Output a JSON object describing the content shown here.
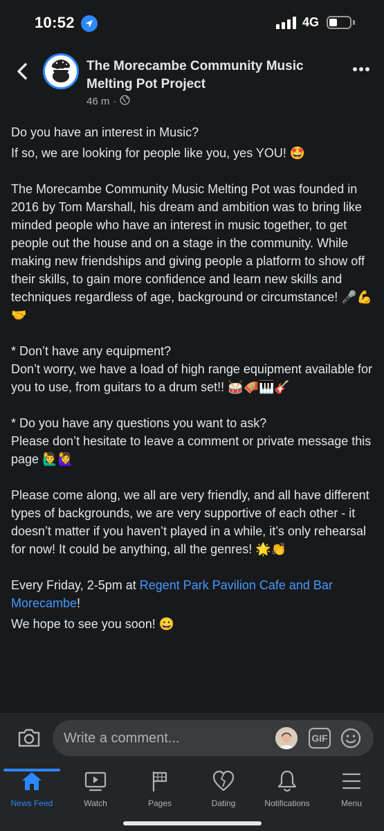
{
  "status_bar": {
    "time": "10:52",
    "network": "4G",
    "location_icon": "location-arrow-icon",
    "signal_icon": "cellular-signal-icon",
    "battery_icon": "battery-icon",
    "battery_level": 0.4
  },
  "post": {
    "page_name": "The Morecambe Community Music Melting Pot Project",
    "time_ago": "46 m",
    "separator": "·",
    "audience_icon": "globe-icon",
    "paragraphs": {
      "p1a": "Do you have an interest in Music?",
      "p1b": "If so, we are looking for people like you, yes YOU! 🤩",
      "p2": "The Morecambe Community Music Melting Pot was founded in 2016 by Tom Marshall, his dream and ambition was to bring like minded people who have an interest in music together, to get people out the house and on a stage in the community. While making new friendships and giving people a platform to show off their skills, to gain more confidence and learn new skills and techniques regardless of age, background or circumstance! 🎤💪🤝",
      "p3a": "* Don’t have any equipment?",
      "p3b": "Don’t worry, we have a load of high range equipment available for you to use, from guitars to a drum set!! 🥁🪗🎹🎸",
      "p4a": "* Do you have any questions you want to ask?",
      "p4b": "Please don’t hesitate to leave a comment or private message this page 🙋‍♂️🙋‍♀️",
      "p5": "Please come along, we all are very friendly, and all have different types of backgrounds, we are very supportive of each other - it doesn’t matter if you haven’t played in a while, it’s only rehearsal for now! It could be anything, all the genres! 🌟👏",
      "p6_prefix": "Every Friday, 2-5pm at ",
      "p6_link": "Regent Park Pavilion Cafe and Bar Morecambe",
      "p6_suffix": "!",
      "p7": "We hope to see you soon! 😀"
    }
  },
  "comment_bar": {
    "placeholder": "Write a comment...",
    "gif_label": "GIF",
    "camera_icon": "camera-icon",
    "emoji_icon": "smiley-icon"
  },
  "tabs": [
    {
      "label": "News Feed",
      "icon": "home-icon",
      "active": true
    },
    {
      "label": "Watch",
      "icon": "video-play-icon",
      "active": false
    },
    {
      "label": "Pages",
      "icon": "flag-icon",
      "active": false
    },
    {
      "label": "Dating",
      "icon": "heart-icon",
      "active": false
    },
    {
      "label": "Notifications",
      "icon": "bell-icon",
      "active": false
    },
    {
      "label": "Menu",
      "icon": "hamburger-menu-icon",
      "active": false
    }
  ],
  "colors": {
    "background": "#18191a",
    "surface": "#242526",
    "accent": "#2d88ff",
    "link": "#4599ff",
    "text_primary": "#e4e6eb",
    "text_secondary": "#b0b3b8"
  }
}
